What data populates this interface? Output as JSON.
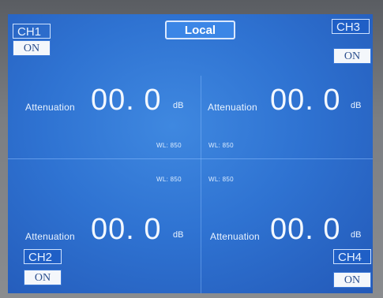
{
  "header": {
    "mode_label": "Local"
  },
  "channels": [
    {
      "name": "CH1",
      "state": "ON",
      "attenuation_label": "Attenuation",
      "attenuation_value": "00. 0",
      "unit": "dB",
      "wl": "WL: 850"
    },
    {
      "name": "CH2",
      "state": "ON",
      "attenuation_label": "Attenuation",
      "attenuation_value": "00. 0",
      "unit": "dB",
      "wl": "WL: 850"
    },
    {
      "name": "CH3",
      "state": "ON",
      "attenuation_label": "Attenuation",
      "attenuation_value": "00. 0",
      "unit": "dB",
      "wl": "WL: 850"
    },
    {
      "name": "CH4",
      "state": "ON",
      "attenuation_label": "Attenuation",
      "attenuation_value": "00. 0",
      "unit": "dB",
      "wl": "WL: 850"
    }
  ],
  "colors": {
    "screen_blue": "#2f73d2",
    "accent": "#3b86e6",
    "button_bg": "#f4f7fb"
  }
}
